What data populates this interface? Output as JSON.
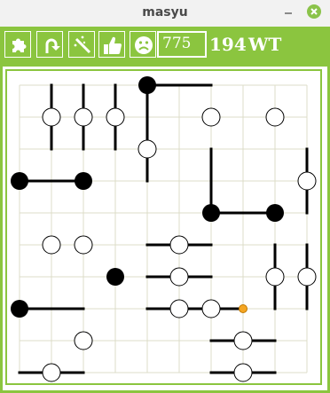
{
  "window": {
    "title": "masyu"
  },
  "toolbar": {
    "buttons": [
      {
        "name": "new-puzzle-button",
        "icon": "puzzle-icon"
      },
      {
        "name": "undo-button",
        "icon": "undo-arrow-icon"
      },
      {
        "name": "hint-button",
        "icon": "magic-wand-icon"
      },
      {
        "name": "check-button",
        "icon": "thumbs-up-icon"
      },
      {
        "name": "give-up-button",
        "icon": "sad-face-icon"
      }
    ],
    "score_value": "775",
    "counter": "194",
    "mode": "WT"
  },
  "colors": {
    "accent": "#8bc53f",
    "grid": "#dcdcc8",
    "ink": "#000000",
    "cursor": "#f5a623"
  },
  "board": {
    "size": 10,
    "white_pearls": [
      [
        1,
        1
      ],
      [
        2,
        1
      ],
      [
        3,
        1
      ],
      [
        6,
        1
      ],
      [
        8,
        1
      ],
      [
        4,
        2
      ],
      [
        9,
        3
      ],
      [
        1,
        5
      ],
      [
        2,
        5
      ],
      [
        5,
        5
      ],
      [
        5,
        6
      ],
      [
        8,
        6
      ],
      [
        9,
        6
      ],
      [
        5,
        7
      ],
      [
        6,
        7
      ],
      [
        2,
        8
      ],
      [
        1,
        9
      ],
      [
        7,
        8
      ],
      [
        7,
        9
      ]
    ],
    "black_pearls": [
      [
        4,
        0
      ],
      [
        0,
        3
      ],
      [
        2,
        3
      ],
      [
        6,
        4
      ],
      [
        8,
        4
      ],
      [
        3,
        6
      ],
      [
        0,
        7
      ]
    ],
    "segments": [
      [
        4,
        0,
        6,
        0
      ],
      [
        4,
        0,
        4,
        3
      ],
      [
        1,
        0,
        1,
        2
      ],
      [
        2,
        0,
        2,
        2
      ],
      [
        3,
        0,
        3,
        2
      ],
      [
        0,
        3,
        2,
        3
      ],
      [
        6,
        2,
        6,
        4
      ],
      [
        6,
        4,
        8,
        4
      ],
      [
        9,
        2,
        9,
        4
      ],
      [
        4,
        5,
        6,
        5
      ],
      [
        4,
        6,
        6,
        6
      ],
      [
        4,
        7,
        7,
        7
      ],
      [
        0,
        7,
        2,
        7
      ],
      [
        8,
        5,
        8,
        7
      ],
      [
        9,
        5,
        9,
        7
      ],
      [
        6,
        8,
        8,
        8
      ],
      [
        6,
        9,
        8,
        9
      ],
      [
        0,
        9,
        2,
        9
      ]
    ],
    "cursor": [
      7,
      7
    ]
  }
}
